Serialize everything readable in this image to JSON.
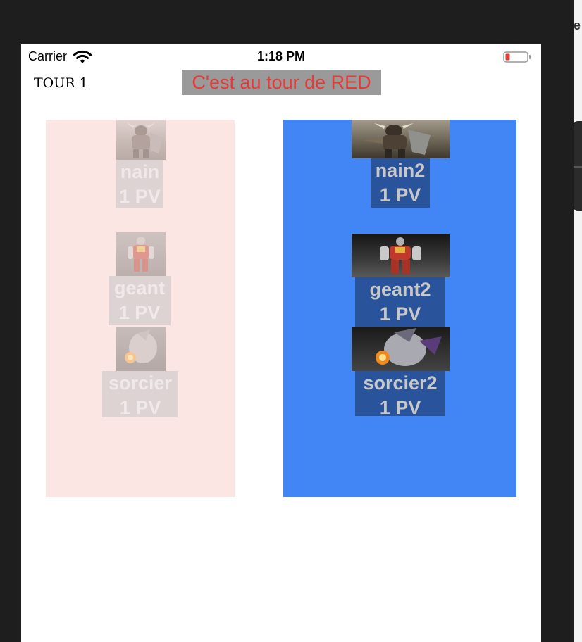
{
  "status_bar": {
    "carrier": "Carrier",
    "time": "1:18 PM",
    "battery_color": "#e53a35"
  },
  "side_window": {
    "letter": "e"
  },
  "header": {
    "turn_label": "TOUR 1",
    "turn_message": "C'est au tour de RED",
    "message_color": "#e53a35",
    "message_bg": "#9a9a9a"
  },
  "teams": {
    "red": {
      "color": "#fce6e4",
      "units": [
        {
          "name": "nain",
          "hp": "1 PV",
          "portrait": "dwarf-warrior-portrait"
        },
        {
          "name": "geant",
          "hp": "1 PV",
          "portrait": "giant-colossus-portrait"
        },
        {
          "name": "sorcier",
          "hp": "1 PV",
          "portrait": "sorcerer-portrait"
        }
      ]
    },
    "blue": {
      "color": "#4186f4",
      "units": [
        {
          "name": "nain2",
          "hp": "1 PV",
          "portrait": "dwarf-warrior-portrait"
        },
        {
          "name": "geant2",
          "hp": "1 PV",
          "portrait": "giant-colossus-portrait"
        },
        {
          "name": "sorcier2",
          "hp": "1 PV",
          "portrait": "sorcerer-portrait"
        }
      ]
    }
  }
}
